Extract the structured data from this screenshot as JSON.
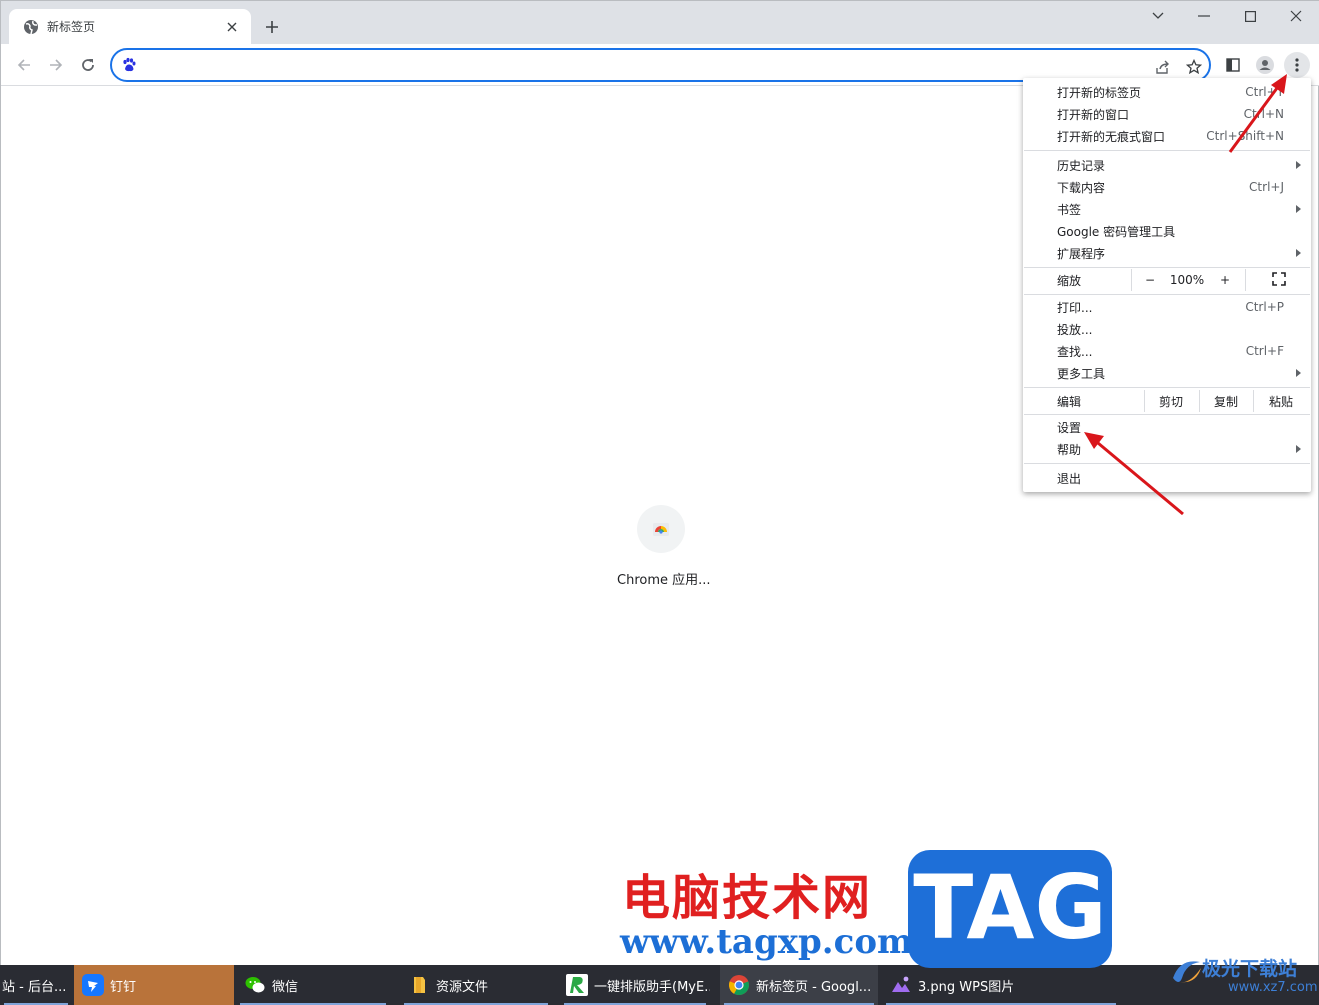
{
  "browser": {
    "tab_title": "新标签页",
    "omnibox_value": "",
    "shortcut_label": "Chrome 应用..."
  },
  "menu": {
    "items_group1": [
      {
        "label": "打开新的标签页",
        "shortcut": "Ctrl+T"
      },
      {
        "label": "打开新的窗口",
        "shortcut": "Ctrl+N"
      },
      {
        "label": "打开新的无痕式窗口",
        "shortcut": "Ctrl+Shift+N"
      }
    ],
    "items_group2": [
      {
        "label": "历史记录",
        "shortcut": ""
      },
      {
        "label": "下载内容",
        "shortcut": "Ctrl+J"
      },
      {
        "label": "书签",
        "shortcut": ""
      },
      {
        "label": "Google 密码管理工具",
        "shortcut": ""
      },
      {
        "label": "扩展程序",
        "shortcut": ""
      }
    ],
    "zoom": {
      "label": "缩放",
      "minus": "−",
      "value": "100%",
      "plus": "+"
    },
    "items_group3": [
      {
        "label": "打印...",
        "shortcut": "Ctrl+P"
      },
      {
        "label": "投放...",
        "shortcut": ""
      },
      {
        "label": "查找...",
        "shortcut": "Ctrl+F"
      },
      {
        "label": "更多工具",
        "shortcut": ""
      }
    ],
    "edit": {
      "label": "编辑",
      "cut": "剪切",
      "copy": "复制",
      "paste": "粘贴"
    },
    "items_group4": [
      {
        "label": "设置"
      },
      {
        "label": "帮助"
      }
    ],
    "exit": "退出"
  },
  "taskbar": {
    "items": [
      {
        "label": "站 - 后台..."
      },
      {
        "label": "钉钉"
      },
      {
        "label": "微信"
      },
      {
        "label": "资源文件"
      },
      {
        "label": "一键排版助手(MyE..."
      },
      {
        "label": "新标签页 - Googl..."
      },
      {
        "label": "3.png  WPS图片"
      }
    ]
  },
  "watermark": {
    "cn_text": "电脑技术网",
    "url": "www.tagxp.com",
    "tag": "TAG",
    "site_name": "极光下载站",
    "site_url": "www.xz7.com"
  },
  "colors": {
    "accent": "#1a73e8",
    "annotation_arrow": "#d9161b",
    "taskbar": "#2a2c33"
  }
}
